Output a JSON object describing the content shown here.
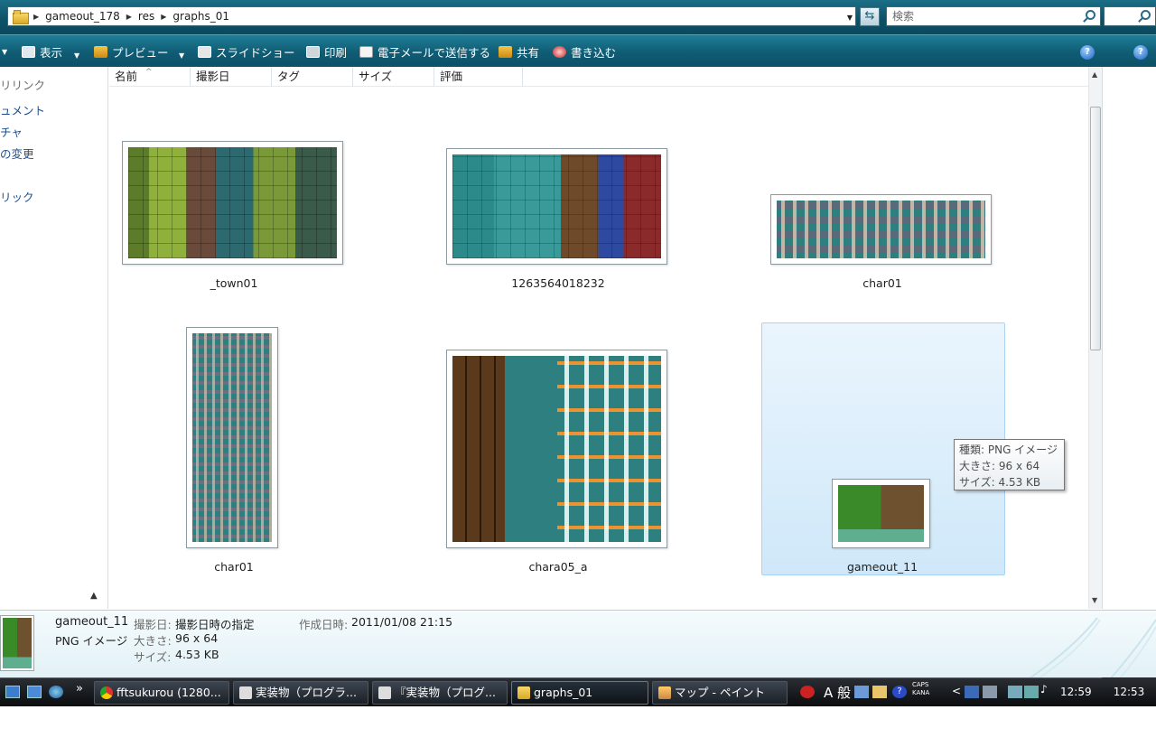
{
  "address": {
    "crumbs": [
      "gameout_178",
      "res",
      "graphs_01"
    ],
    "search_placeholder": "検索"
  },
  "toolbar": {
    "view": "表示",
    "preview": "プレビュー",
    "slideshow": "スライドショー",
    "print": "印刷",
    "email": "電子メールで送信する",
    "share": "共有",
    "burn": "書き込む"
  },
  "nav": {
    "items": [
      "リリンク",
      "ュメント",
      "チャ",
      "の変更",
      "リック"
    ]
  },
  "columns": [
    "名前",
    "撮影日",
    "タグ",
    "サイズ",
    "評価"
  ],
  "files": [
    {
      "name": "_town01"
    },
    {
      "name": "1263564018232"
    },
    {
      "name": "char01"
    },
    {
      "name": "char01"
    },
    {
      "name": "chara05_a"
    },
    {
      "name": "gameout_11"
    }
  ],
  "tooltip": {
    "type": "種類: PNG イメージ",
    "size": "大きさ: 96 x 64",
    "filesize": "サイズ: 4.53 KB"
  },
  "details": {
    "filename": "gameout_11",
    "filetype": "PNG イメージ",
    "date_taken_key": "撮影日:",
    "date_taken_val": "撮影日時の指定",
    "dimensions_key": "大きさ:",
    "dimensions_val": "96 x 64",
    "size_key": "サイズ:",
    "size_val": "4.53 KB",
    "created_key": "作成日時:",
    "created_val": "2011/01/08 21:15"
  },
  "taskbar": {
    "tasks": [
      "fftsukurou (1280...",
      "実装物（プログラ...",
      "『実装物（プログ...",
      "graphs_01",
      "マップ - ペイント"
    ],
    "ime": "A 般",
    "caps": "CAPS",
    "kana": "KANA",
    "clock": "12:59",
    "clock2": "12:53"
  },
  "colors": {
    "accent": "#0f5c74",
    "selection": "#cfe8f9"
  }
}
